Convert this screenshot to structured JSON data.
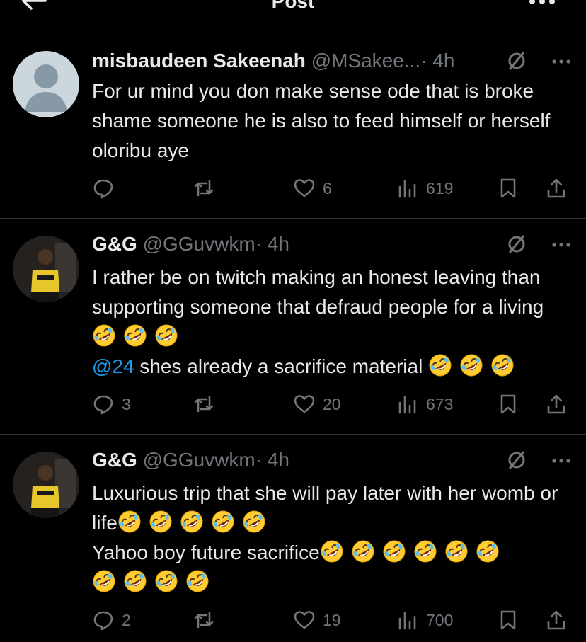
{
  "header": {
    "title": "Post",
    "back_icon": "arrow-left-icon",
    "more_icon": "more-horizontal-icon"
  },
  "posts": [
    {
      "name": "misbaudeen Sakeenah",
      "handle": "@MSakee...",
      "time": "· 4h",
      "text": "For ur mind you don make sense ode that is broke shame someone he is also to feed himself or herself oloribu aye",
      "replies": "",
      "reposts": "",
      "likes": "6",
      "views": "619"
    },
    {
      "name": "G&G",
      "handle": "@GGuvwkm",
      "time": "· 4h",
      "text_line1": "I rather be on twitch making an honest leaving than supporting someone that defraud people for a living",
      "mention": "@24",
      "text_line2": " shes already a sacrifice material",
      "replies": "3",
      "reposts": "",
      "likes": "20",
      "views": "673"
    },
    {
      "name": "G&G",
      "handle": "@GGuvwkm",
      "time": "· 4h",
      "text_line1": "Luxurious trip that she will pay later with her womb or life",
      "text_line2": "Yahoo boy future sacrifice",
      "replies": "2",
      "reposts": "",
      "likes": "19",
      "views": "700"
    }
  ],
  "colors": {
    "background": "#000000",
    "text": "#e7e9ea",
    "muted": "#71767b",
    "link": "#1d9bf0",
    "divider": "#2f3336"
  },
  "icons": [
    "reply-icon",
    "repost-icon",
    "like-icon",
    "views-icon",
    "bookmark-icon",
    "share-icon",
    "grok-icon",
    "rofl-emoji"
  ]
}
